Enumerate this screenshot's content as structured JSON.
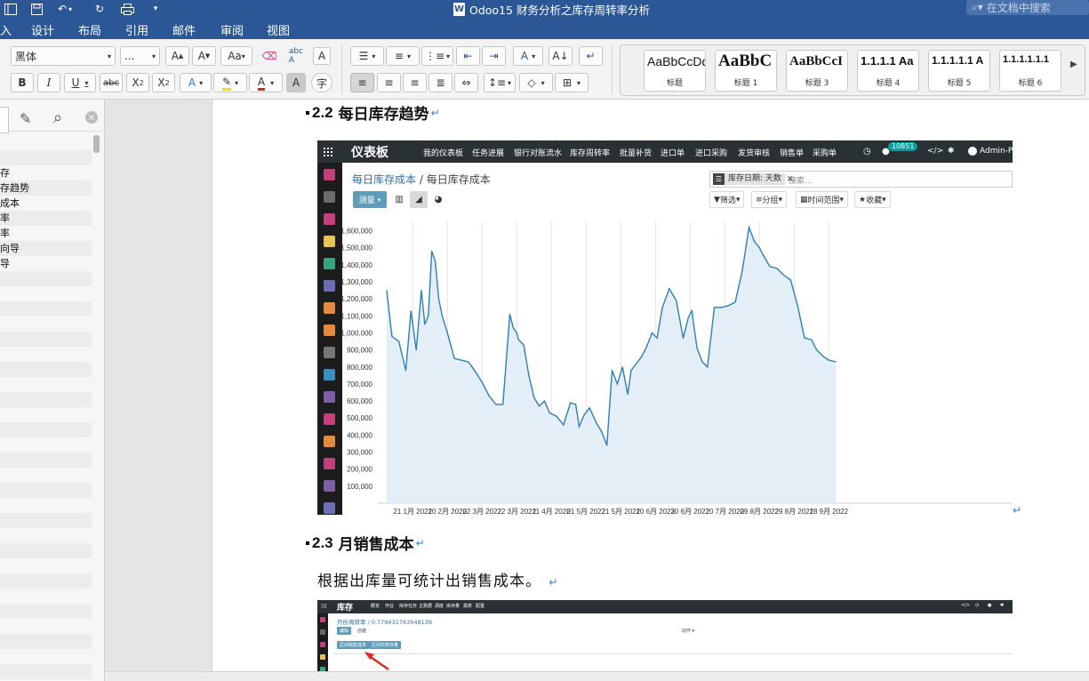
{
  "titlebar": {
    "title": "Odoo15 财务分析之库存周转率分析",
    "search_placeholder": "在文档中搜索"
  },
  "ribbon_tabs": [
    "入",
    "设计",
    "布局",
    "引用",
    "邮件",
    "审阅",
    "视图"
  ],
  "ribbon": {
    "font_name": "黑体",
    "font_size": "...",
    "styles": [
      {
        "sample": "AaBbCcDd",
        "name": "标题"
      },
      {
        "sample": "AaBbC",
        "name": "标题 1"
      },
      {
        "sample": "AaBbCcI",
        "name": "标题 3"
      },
      {
        "sample": "1.1.1.1 Aa",
        "name": "标题 4"
      },
      {
        "sample": "1.1.1.1.1 A",
        "name": "标题 5"
      },
      {
        "sample": "1.1.1.1.1.1",
        "name": "标题 6"
      }
    ]
  },
  "nav_pane": {
    "items": [
      "存",
      "存趋势",
      "成本",
      "率",
      "率",
      "向导",
      "导"
    ]
  },
  "document": {
    "h2_2": {
      "num": "2.2",
      "text": "每日库存趋势"
    },
    "h2_3": {
      "num": "2.3",
      "text": "月销售成本"
    },
    "para": "根据出库量可统计出销售成本。"
  },
  "screenshot1": {
    "brand": "仪表板",
    "menu": [
      "我的仪表板",
      "任务进展",
      "银行对账流水",
      "库存周转率",
      "批量补货",
      "进口单",
      "进口采购",
      "发货审核",
      "销售单",
      "采购单"
    ],
    "badge": "10851",
    "user": "Admin-Pe",
    "breadcrumb_link": "每日库存成本",
    "breadcrumb_sep": "/",
    "breadcrumb_current": "每日库存成本",
    "measure_label": "测量",
    "facet": "库存日期: 天数",
    "search_placeholder": "搜索...",
    "filters": [
      "筛选",
      "分组",
      "时间范围",
      "收藏"
    ]
  },
  "chart_data": {
    "type": "area",
    "title": "",
    "xlabel": "",
    "ylabel": "",
    "ylim": [
      0,
      1650000
    ],
    "yticks": [
      100000,
      200000,
      300000,
      400000,
      500000,
      600000,
      700000,
      800000,
      900000,
      1000000,
      1100000,
      1200000,
      1300000,
      1400000,
      1500000,
      1600000
    ],
    "ytick_labels": [
      "100,000",
      "200,000",
      "300,000",
      "400,000",
      "500,000",
      "600,000",
      "700,000",
      "800,000",
      "900,000",
      "1,000,000",
      "1,100,000",
      "1,200,000",
      "1,300,000",
      "1,400,000",
      "1,500,000",
      "1,600,000"
    ],
    "xticks": [
      "21 1月 2022",
      "10 2月 2022",
      "02 3月 2022",
      "22 3月 2022",
      "11 4月 2022",
      "01 5月 2022",
      "21 5月 2022",
      "10 6月 2022",
      "30 6月 2022",
      "20 7月 2022",
      "09 8月 2022",
      "29 8月 2022",
      "18 9月 2022"
    ],
    "x_start": "2022-01-06",
    "x": [
      "2022-01-06",
      "2022-01-09",
      "2022-01-13",
      "2022-01-17",
      "2022-01-20",
      "2022-01-23",
      "2022-01-26",
      "2022-01-28",
      "2022-01-30",
      "2022-02-01",
      "2022-02-03",
      "2022-02-05",
      "2022-02-07",
      "2022-02-10",
      "2022-02-14",
      "2022-02-18",
      "2022-02-22",
      "2022-02-25",
      "2022-03-02",
      "2022-03-06",
      "2022-03-10",
      "2022-03-14",
      "2022-03-18",
      "2022-03-20",
      "2022-03-22",
      "2022-03-23",
      "2022-03-26",
      "2022-03-29",
      "2022-04-01",
      "2022-04-04",
      "2022-04-07",
      "2022-04-10",
      "2022-04-14",
      "2022-04-18",
      "2022-04-22",
      "2022-04-25",
      "2022-04-27",
      "2022-04-30",
      "2022-05-03",
      "2022-05-07",
      "2022-05-10",
      "2022-05-13",
      "2022-05-16",
      "2022-05-19",
      "2022-05-22",
      "2022-05-25",
      "2022-05-27",
      "2022-05-30",
      "2022-06-02",
      "2022-06-05",
      "2022-06-08",
      "2022-06-11",
      "2022-06-14",
      "2022-06-18",
      "2022-06-22",
      "2022-06-26",
      "2022-06-29",
      "2022-07-01",
      "2022-07-04",
      "2022-07-07",
      "2022-07-10",
      "2022-07-14",
      "2022-07-18",
      "2022-07-22",
      "2022-07-26",
      "2022-07-30",
      "2022-08-03",
      "2022-08-06",
      "2022-08-09",
      "2022-08-11",
      "2022-08-15",
      "2022-08-19",
      "2022-08-23",
      "2022-08-27",
      "2022-08-31",
      "2022-09-04",
      "2022-09-08",
      "2022-09-11",
      "2022-09-15",
      "2022-09-18",
      "2022-09-22"
    ],
    "values": [
      1250000,
      980000,
      950000,
      780000,
      1130000,
      900000,
      1250000,
      1050000,
      1100000,
      1480000,
      1420000,
      1200000,
      1100000,
      1000000,
      850000,
      840000,
      830000,
      790000,
      710000,
      630000,
      580000,
      580000,
      1110000,
      1030000,
      1000000,
      960000,
      930000,
      750000,
      620000,
      570000,
      600000,
      530000,
      510000,
      460000,
      590000,
      580000,
      450000,
      520000,
      560000,
      470000,
      420000,
      340000,
      780000,
      700000,
      800000,
      640000,
      780000,
      820000,
      860000,
      920000,
      1000000,
      970000,
      1150000,
      1260000,
      1190000,
      970000,
      1090000,
      1130000,
      910000,
      830000,
      800000,
      1150000,
      1150000,
      1160000,
      1180000,
      1360000,
      1620000,
      1540000,
      1500000,
      1460000,
      1390000,
      1380000,
      1340000,
      1310000,
      1160000,
      970000,
      960000,
      900000,
      860000,
      840000,
      830000
    ]
  },
  "screenshot2": {
    "brand": "库存",
    "menu": [
      "概览",
      "作业",
      "库存任务",
      "主数据",
      "调度",
      "库存量",
      "报表",
      "配置"
    ],
    "breadcrumb": "月份周转率 / 0.779431763548139",
    "btn_edit": "编辑",
    "btn_create": "创建",
    "actions": "动作",
    "tab1": "区间销售成本",
    "tab2": "区间日库存量"
  }
}
